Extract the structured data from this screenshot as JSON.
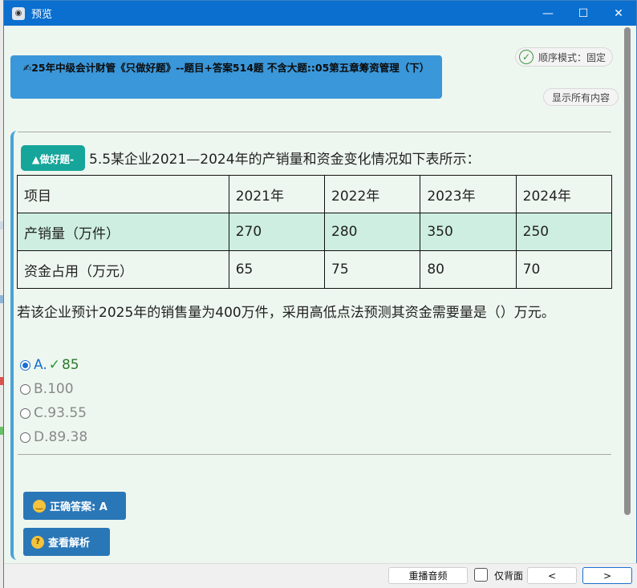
{
  "window": {
    "title": "预览",
    "minimize_symbol": "—",
    "maximize_symbol": "☐",
    "close_symbol": "✕"
  },
  "header": {
    "banner_icon": "✍",
    "banner_text": "25年中级会计财管《只做好题》--题目+答案514题 不含大题::05第五章筹资管理（下）",
    "mode_label": "顺序模式：固定",
    "show_all_label": "显示所有内容"
  },
  "question": {
    "tag": "▲做好题-",
    "title": "5.5某企业2021—2024年的产销量和资金变化情况如下表所示：",
    "table": {
      "header": [
        "项目",
        "2021年",
        "2022年",
        "2023年",
        "2024年"
      ],
      "rows": [
        [
          "产销量（万件）",
          "270",
          "280",
          "350",
          "250"
        ],
        [
          "资金占用（万元）",
          "65",
          "75",
          "80",
          "70"
        ]
      ]
    },
    "text": "若该企业预计2025年的销售量为400万件，采用高低点法预测其资金需要量是（）万元。",
    "options": [
      {
        "letter": "A.",
        "tick": "✓",
        "value": "85",
        "selected": true
      },
      {
        "letter": "B.",
        "tick": "",
        "value": "100",
        "selected": false
      },
      {
        "letter": "C.",
        "tick": "",
        "value": "93.55",
        "selected": false
      },
      {
        "letter": "D.",
        "tick": "",
        "value": "89.38",
        "selected": false
      }
    ]
  },
  "buttons": {
    "answer_label": "正确答案: A",
    "analysis_label": "查看解析"
  },
  "footer": {
    "replay_label": "重播音频",
    "back_only_label": "仅背面",
    "prev_label": "<",
    "next_label": ">"
  },
  "colors": {
    "titlebar": "#0a6fcf",
    "banner": "#3a97d9",
    "tag": "#16a59a",
    "table_alt_row": "#cdeee0",
    "correct_green": "#1f9b30",
    "button_blue": "#2a77b7"
  }
}
